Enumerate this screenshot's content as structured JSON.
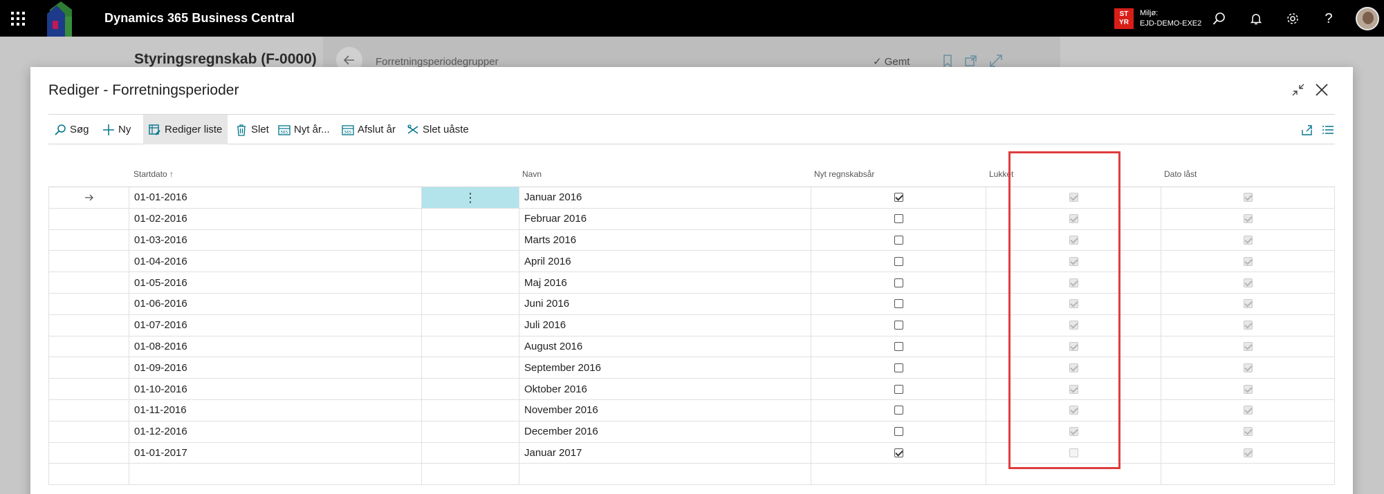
{
  "topbar": {
    "app_title": "Dynamics 365 Business Central",
    "env_badge_line1": "ST",
    "env_badge_line2": "YR",
    "env_label": "Miljø:",
    "env_name": "EJD-DEMO-EXE2"
  },
  "background_page": {
    "title": "Styringsregnskab (F-0000)",
    "subtitle": "Forretningsperiodegrupper",
    "saved_status": "Gemt"
  },
  "dialog": {
    "title": "Rediger - Forretningsperioder",
    "actions": [
      {
        "label": "Søg",
        "icon": "search-icon"
      },
      {
        "label": "Ny",
        "icon": "plus-icon"
      },
      {
        "label": "Rediger liste",
        "icon": "edit-list-icon",
        "active": true
      },
      {
        "label": "Slet",
        "icon": "trash-icon"
      },
      {
        "label": "Nyt år...",
        "icon": "new-year-icon"
      },
      {
        "label": "Afslut år",
        "icon": "close-year-icon"
      },
      {
        "label": "Slet uåste",
        "icon": "delete-unlocked-icon"
      }
    ]
  },
  "table": {
    "columns": {
      "start_date": "Startdato",
      "sort_indicator": "↑",
      "name": "Navn",
      "new_fiscal_year": "Nyt regnskabsår",
      "closed": "Lukket",
      "date_locked": "Dato låst"
    },
    "rows": [
      {
        "start_date": "01-01-2016",
        "name": "Januar 2016",
        "new_fiscal_year": true,
        "closed": true,
        "date_locked": true,
        "current": true
      },
      {
        "start_date": "01-02-2016",
        "name": "Februar 2016",
        "new_fiscal_year": false,
        "closed": true,
        "date_locked": true
      },
      {
        "start_date": "01-03-2016",
        "name": "Marts 2016",
        "new_fiscal_year": false,
        "closed": true,
        "date_locked": true
      },
      {
        "start_date": "01-04-2016",
        "name": "April 2016",
        "new_fiscal_year": false,
        "closed": true,
        "date_locked": true
      },
      {
        "start_date": "01-05-2016",
        "name": "Maj 2016",
        "new_fiscal_year": false,
        "closed": true,
        "date_locked": true
      },
      {
        "start_date": "01-06-2016",
        "name": "Juni 2016",
        "new_fiscal_year": false,
        "closed": true,
        "date_locked": true
      },
      {
        "start_date": "01-07-2016",
        "name": "Juli 2016",
        "new_fiscal_year": false,
        "closed": true,
        "date_locked": true
      },
      {
        "start_date": "01-08-2016",
        "name": "August 2016",
        "new_fiscal_year": false,
        "closed": true,
        "date_locked": true
      },
      {
        "start_date": "01-09-2016",
        "name": "September 2016",
        "new_fiscal_year": false,
        "closed": true,
        "date_locked": true
      },
      {
        "start_date": "01-10-2016",
        "name": "Oktober 2016",
        "new_fiscal_year": false,
        "closed": true,
        "date_locked": true
      },
      {
        "start_date": "01-11-2016",
        "name": "November 2016",
        "new_fiscal_year": false,
        "closed": true,
        "date_locked": true
      },
      {
        "start_date": "01-12-2016",
        "name": "December 2016",
        "new_fiscal_year": false,
        "closed": true,
        "date_locked": true
      },
      {
        "start_date": "01-01-2017",
        "name": "Januar 2017",
        "new_fiscal_year": true,
        "closed": false,
        "date_locked": true
      }
    ]
  },
  "colors": {
    "topbar": "#000000",
    "env_badge": "#d91e18",
    "selected_cell": "#b3e4ec",
    "highlight_box": "#e03c3c",
    "accent_icon": "#00748c"
  }
}
